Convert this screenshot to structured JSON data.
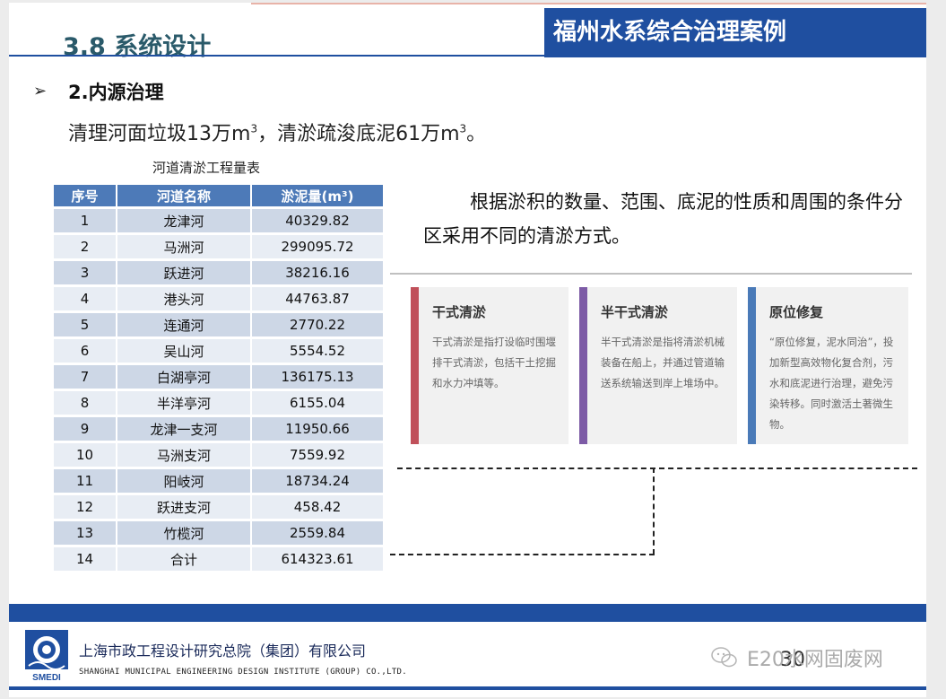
{
  "header": {
    "section_title": "3.8 系统设计",
    "case_title": "福州水系综合治理案例"
  },
  "content": {
    "bullet": "➢",
    "sub_heading": "2.内源治理",
    "summary": {
      "part1": "清理河面垃圾13万m",
      "sup1": "3",
      "part2": "，清淤疏浚底泥61万m",
      "sup2": "3",
      "part3": "。"
    },
    "table_caption": "河道清淤工程量表",
    "table": {
      "headers": [
        "序号",
        "河道名称",
        "淤泥量(m³)"
      ],
      "rows": [
        [
          "1",
          "龙津河",
          "40329.82"
        ],
        [
          "2",
          "马洲河",
          "299095.72"
        ],
        [
          "3",
          "跃进河",
          "38216.16"
        ],
        [
          "4",
          "港头河",
          "44763.87"
        ],
        [
          "5",
          "连通河",
          "2770.22"
        ],
        [
          "6",
          "吴山河",
          "5554.52"
        ],
        [
          "7",
          "白湖亭河",
          "136175.13"
        ],
        [
          "8",
          "半洋亭河",
          "6155.04"
        ],
        [
          "9",
          "龙津一支河",
          "11950.66"
        ],
        [
          "10",
          "马洲支河",
          "7559.92"
        ],
        [
          "11",
          "阳岐河",
          "18734.24"
        ],
        [
          "12",
          "跃进支河",
          "458.42"
        ],
        [
          "13",
          "竹榄河",
          "2559.84"
        ],
        [
          "14",
          "合计",
          "614323.61"
        ]
      ]
    },
    "method_text": "根据淤积的数量、范围、底泥的性质和周围的条件分区采用不同的清淤方式。",
    "cards": [
      {
        "title": "干式清淤",
        "desc": "干式清淤是指打设临时围堰排干式清淤，包括干土挖掘和水力冲填等。",
        "color": "#c0505a"
      },
      {
        "title": "半干式清淤",
        "desc": "半干式清淤是指将清淤机械装备在船上，并通过管道输送系统输送到岸上堆场中。",
        "color": "#7d5ba6"
      },
      {
        "title": "原位修复",
        "desc": "“原位修复，泥水同治”，投加新型高效物化复合剂，污水和底泥进行治理，避免污染转移。同时激活土著微生物。",
        "color": "#4a7ab8"
      }
    ]
  },
  "footer": {
    "logo_text": "SMEDI",
    "org_cn": "上海市政工程设计研究总院（集团）有限公司",
    "org_en": "SHANGHAI MUNICIPAL ENGINEERING DESIGN INSTITUTE (GROUP) CO.,LTD.",
    "page_number": "30",
    "watermark_icon": "wechat-icon",
    "watermark": "E20水网固废网"
  },
  "colors": {
    "brand_blue": "#1f4fa0",
    "table_header": "#4d7ab8",
    "row_odd": "#cdd7e6",
    "row_even": "#e8edf4"
  }
}
